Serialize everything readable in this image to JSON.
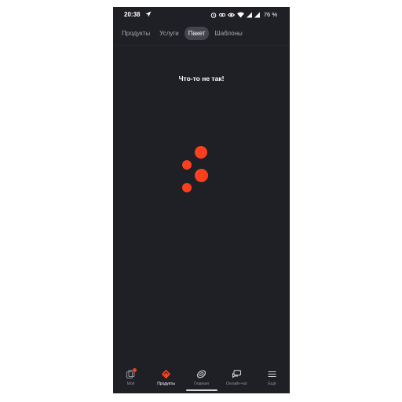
{
  "status_bar": {
    "time": "20:38",
    "battery": "76 %",
    "icons": [
      "send-icon",
      "alarm-icon",
      "link-icon",
      "eye-icon",
      "wifi-icon",
      "signal-icon",
      "signal-icon"
    ]
  },
  "tabs": [
    {
      "label": "Продукты",
      "active": false
    },
    {
      "label": "Услуги",
      "active": false
    },
    {
      "label": "Пакет",
      "active": true
    },
    {
      "label": "Шаблоны",
      "active": false
    }
  ],
  "main": {
    "error_message": "Что-то не так!"
  },
  "bottom_nav": [
    {
      "label": "Моё",
      "icon": "cards-icon",
      "badge": true,
      "active": false
    },
    {
      "label": "Продукты",
      "icon": "products-icon",
      "active": true
    },
    {
      "label": "Главная",
      "icon": "home-ring-icon",
      "active": false
    },
    {
      "label": "Онлайн-чат",
      "icon": "chat-icon",
      "active": false
    },
    {
      "label": "Ещё",
      "icon": "menu-icon",
      "active": false
    }
  ],
  "colors": {
    "background": "#1f2025",
    "accent": "#fc3f1d",
    "tab_active": "#45464d",
    "text_muted": "#a7a9b0"
  }
}
